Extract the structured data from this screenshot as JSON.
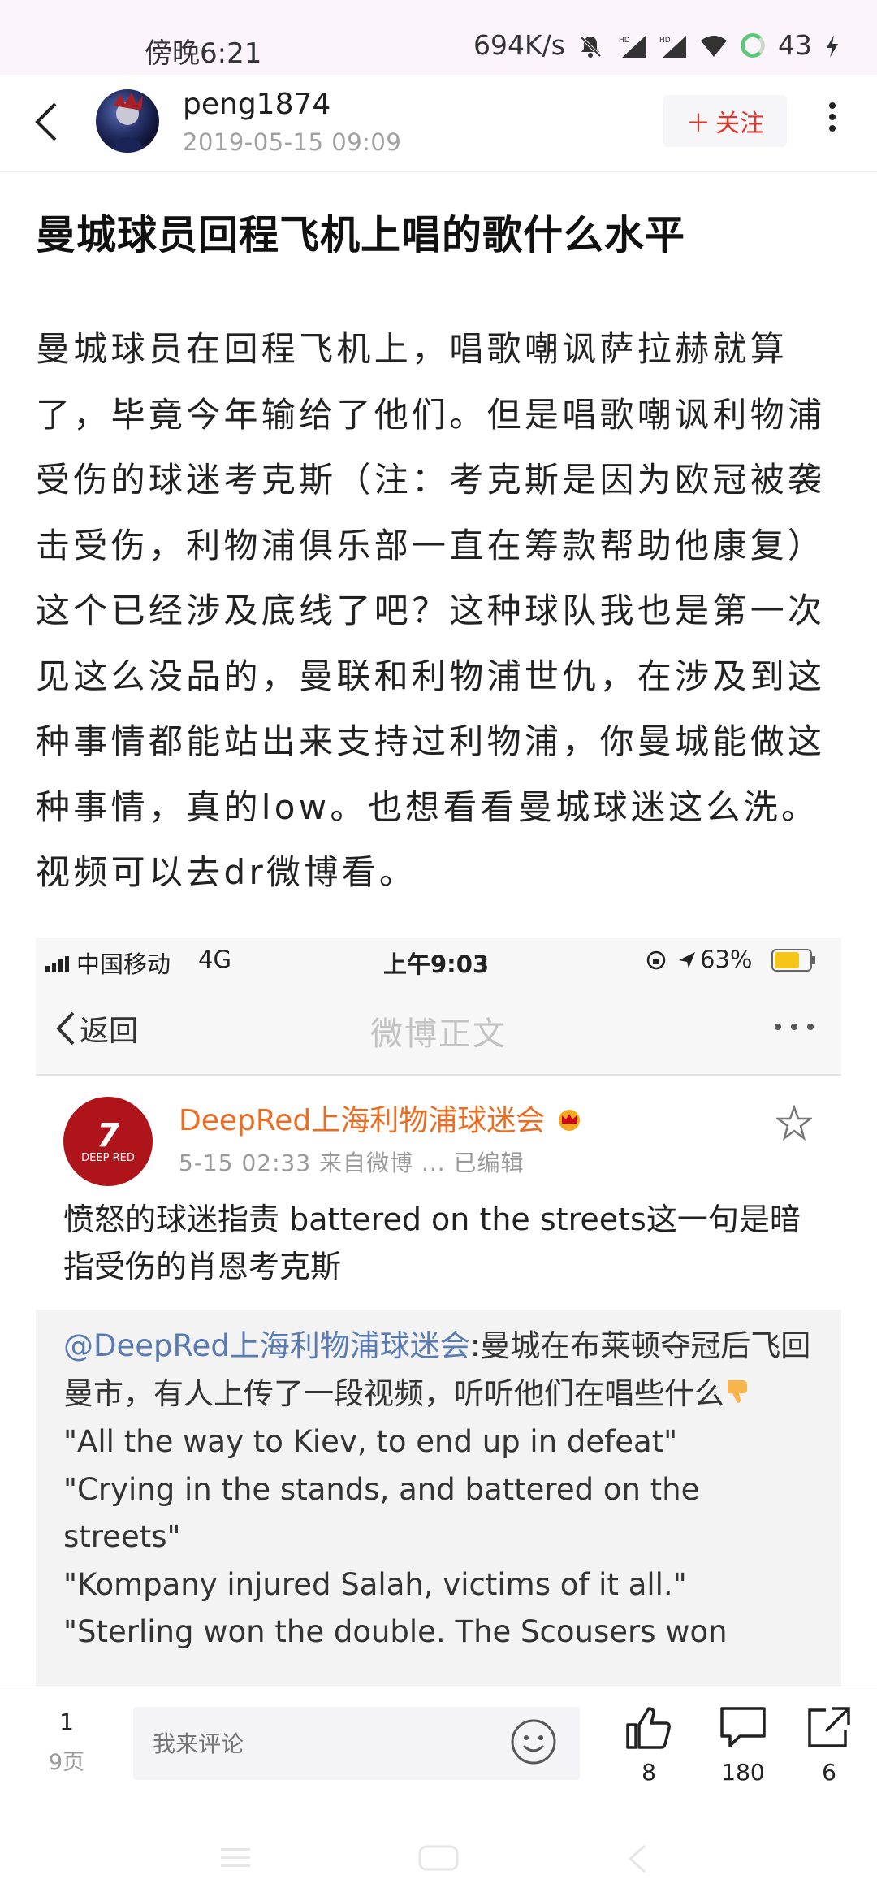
{
  "status_bar": {
    "time": "傍晚6:21",
    "speed": "694K/s",
    "battery": "43",
    "icons": [
      "mute-icon",
      "hd-signal-icon",
      "hd-signal-icon",
      "wifi-icon",
      "battery-ring-icon",
      "charging-icon"
    ]
  },
  "header": {
    "username": "peng1874",
    "date": "2019-05-15 09:09",
    "follow_label": "关注",
    "follow_prefix": "＋"
  },
  "article": {
    "title": "曼城球员回程飞机上唱的歌什么水平",
    "body": "曼城球员在回程飞机上，唱歌嘲讽萨拉赫就算了，毕竟今年输给了他们。但是唱歌嘲讽利物浦受伤的球迷考克斯（注：考克斯是因为欧冠被袭击受伤，利物浦俱乐部一直在筹款帮助他康复）这个已经涉及底线了吧？这种球队我也是第一次见这么没品的，曼联和利物浦世仇，在涉及到这种事情都能站出来支持过利物浦，你曼城能做这种事情，真的low。也想看看曼城球迷这么洗。视频可以去dr微博看。"
  },
  "embed": {
    "status": {
      "carrier": "中国移动",
      "network": "4G",
      "time": "上午9:03",
      "battery": "63%"
    },
    "nav": {
      "back_label": "返回",
      "title": "微博正文"
    },
    "post": {
      "author": "DeepRed上海利物浦球迷会",
      "meta": "5-15 02:33  来自微博 ...  已编辑",
      "avatar_text": "DEEP RED",
      "text": "愤怒的球迷指责 battered on the streets这一句是暗指受伤的肖恩考克斯"
    },
    "quote": {
      "mention": "@DeepRed上海利物浦球迷会",
      "lead": ":曼城在布莱顿夺冠后飞回曼市，有人上传了一段视频，听听他们在唱些什么",
      "lines": [
        "\"All the way to Kiev, to end up in defeat\"",
        "\"Crying in the stands, and battered on the",
        "streets\"",
        "\"Kompany injured Salah, victims of it all.\"",
        "\"Sterling won the double. The Scousers won"
      ]
    }
  },
  "bottom_bar": {
    "page_current": "1",
    "page_total": "9页",
    "comment_placeholder": "我来评论",
    "likes": "8",
    "comments": "180",
    "shares": "6"
  }
}
